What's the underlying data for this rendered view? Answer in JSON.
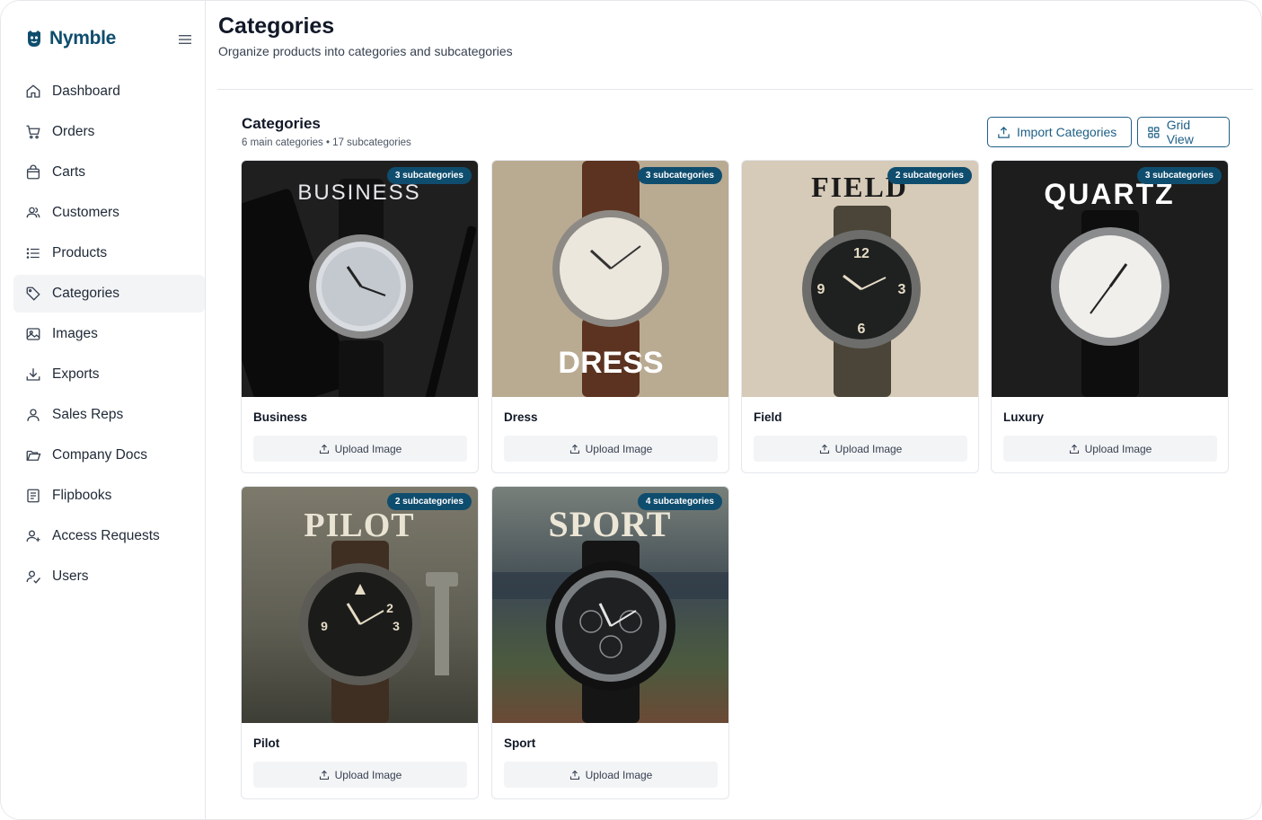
{
  "brand": {
    "name": "Nymble",
    "color": "#0f4d6e"
  },
  "sidebar": {
    "items": [
      {
        "label": "Dashboard",
        "icon": "home-icon"
      },
      {
        "label": "Orders",
        "icon": "cart-icon"
      },
      {
        "label": "Carts",
        "icon": "bag-icon"
      },
      {
        "label": "Customers",
        "icon": "users-icon"
      },
      {
        "label": "Products",
        "icon": "list-icon"
      },
      {
        "label": "Categories",
        "icon": "tag-icon",
        "active": true
      },
      {
        "label": "Images",
        "icon": "image-icon"
      },
      {
        "label": "Exports",
        "icon": "download-icon"
      },
      {
        "label": "Sales Reps",
        "icon": "user-icon"
      },
      {
        "label": "Company Docs",
        "icon": "folder-icon"
      },
      {
        "label": "Flipbooks",
        "icon": "book-icon"
      },
      {
        "label": "Access Requests",
        "icon": "user-plus-icon"
      },
      {
        "label": "Users",
        "icon": "user-check-icon"
      }
    ]
  },
  "header": {
    "title": "Categories",
    "subtitle": "Organize products into categories and subcategories"
  },
  "section": {
    "title": "Categories",
    "meta": "6 main categories • 17 subcategories",
    "import_label": "Import Categories",
    "view_label": "Grid View"
  },
  "cards": [
    {
      "name": "Business",
      "badge": "3 subcategories",
      "image_text": "BUSINESS",
      "upload_label": "Upload Image"
    },
    {
      "name": "Dress",
      "badge": "3 subcategories",
      "image_text": "DRESS",
      "upload_label": "Upload Image"
    },
    {
      "name": "Field",
      "badge": "2 subcategories",
      "image_text": "FIELD",
      "upload_label": "Upload Image"
    },
    {
      "name": "Luxury",
      "badge": "3 subcategories",
      "image_text": "QUARTZ",
      "upload_label": "Upload Image"
    },
    {
      "name": "Pilot",
      "badge": "2 subcategories",
      "image_text": "PILOT",
      "upload_label": "Upload Image"
    },
    {
      "name": "Sport",
      "badge": "4 subcategories",
      "image_text": "SPORT",
      "upload_label": "Upload Image"
    }
  ]
}
